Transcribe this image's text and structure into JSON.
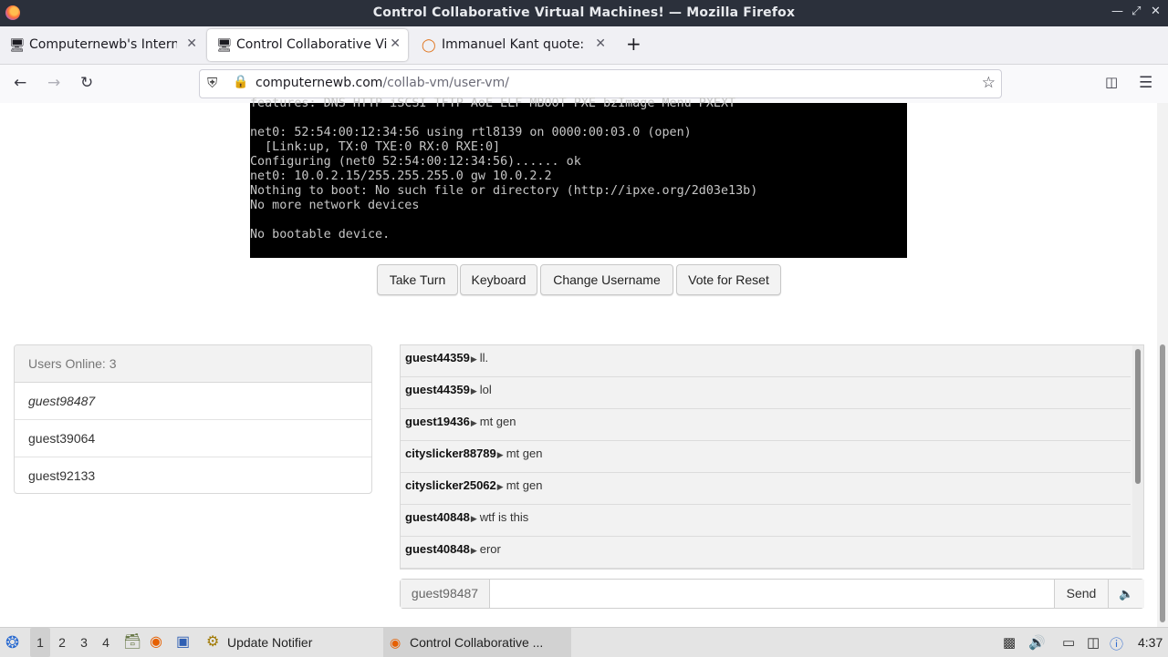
{
  "window": {
    "title": "Control Collaborative Virtual Machines! — Mozilla Firefox"
  },
  "tabs": [
    {
      "label": "Computernewb's Internet",
      "icon": "computernewb-favicon"
    },
    {
      "label": "Control Collaborative Virt",
      "icon": "computernewb-favicon"
    },
    {
      "label": "Immanuel Kant quote: Th",
      "icon": "quote-favicon"
    }
  ],
  "nav": {
    "url_domain": "computernewb.com",
    "url_path": "/collab-vm/user-vm/"
  },
  "vm": {
    "lines": [
      "features: DNS HTTP iSCSI TFTP AoE ELF MBOOT PXE bzImage Menu PXEXT",
      "",
      "net0: 52:54:00:12:34:56 using rtl8139 on 0000:00:03.0 (open)",
      "  [Link:up, TX:0 TXE:0 RX:0 RXE:0]",
      "Configuring (net0 52:54:00:12:34:56)...... ok",
      "net0: 10.0.2.15/255.255.255.0 gw 10.0.2.2",
      "Nothing to boot: No such file or directory (http://ipxe.org/2d03e13b)",
      "No more network devices",
      "",
      "No bootable device."
    ]
  },
  "controls": {
    "take_turn": "Take Turn",
    "keyboard": "Keyboard",
    "change_username": "Change Username",
    "vote_reset": "Vote for Reset"
  },
  "users": {
    "header": "Users Online: 3",
    "list": [
      "guest98487",
      "guest39064",
      "guest92133"
    ]
  },
  "chat": {
    "messages": [
      {
        "user": "guest44359",
        "text": "ll."
      },
      {
        "user": "guest44359",
        "text": "lol"
      },
      {
        "user": "guest19436",
        "text": "mt gen"
      },
      {
        "user": "cityslicker88789",
        "text": "mt gen"
      },
      {
        "user": "cityslicker25062",
        "text": "mt gen"
      },
      {
        "user": "guest40848",
        "text": "wtf is this"
      },
      {
        "user": "guest40848",
        "text": "eror"
      }
    ],
    "username": "guest98487",
    "input_value": "",
    "send_label": "Send"
  },
  "taskbar": {
    "workspaces": [
      "1",
      "2",
      "3",
      "4"
    ],
    "active_workspace": "1",
    "update_notifier": "Update Notifier",
    "active_window": "Control Collaborative ...",
    "clock": "4:37"
  },
  "colors": {
    "titlebar": "#2b303b",
    "vm_bg": "#000000",
    "vm_text": "#c6c6c6"
  }
}
